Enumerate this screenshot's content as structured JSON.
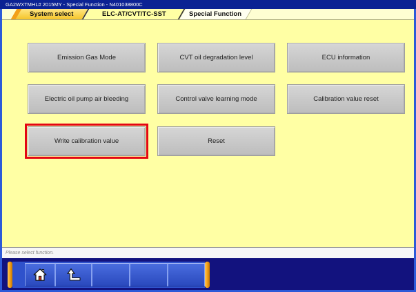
{
  "window": {
    "title": "GA2WXTMHL# 2015MY - Special Function - N401038800C"
  },
  "breadcrumb": {
    "tabs": [
      {
        "label": "System select"
      },
      {
        "label": "ELC-AT/CVT/TC-SST"
      },
      {
        "label": "Special Function"
      }
    ]
  },
  "functions": {
    "buttons": [
      {
        "label": "Emission Gas Mode"
      },
      {
        "label": "CVT oil degradation level"
      },
      {
        "label": "ECU information"
      },
      {
        "label": "Electric oil pump air bleeding"
      },
      {
        "label": "Control valve learning mode"
      },
      {
        "label": "Calibration value reset"
      },
      {
        "label": "Write calibration value",
        "highlighted": true
      },
      {
        "label": "Reset"
      }
    ]
  },
  "status_bar": {
    "message": "Please select function."
  },
  "toolbar": {
    "buttons": [
      {
        "icon": "home-icon"
      },
      {
        "icon": "up-level-icon"
      },
      {
        "icon": null
      },
      {
        "icon": null
      },
      {
        "icon": null
      }
    ]
  },
  "colors": {
    "title-bar": "#0b2293",
    "frame": "#2d5ad8",
    "panel": "#ffffa4",
    "button-face": "#c8c8c8",
    "highlight": "#e30613",
    "toolbar": "#12127e",
    "toolbar-panel": "#2f52cc",
    "toolbar-accent": "#f2a019",
    "tab-gold": "#f5c52a"
  }
}
